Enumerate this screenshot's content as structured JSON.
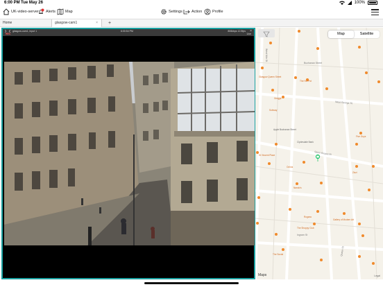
{
  "status": {
    "time": "6:00 PM",
    "date": "Tue May 26",
    "battery": "100%"
  },
  "toolbar": {
    "server": "UK-video-server",
    "alerts": "Alerts",
    "map": "Map",
    "settings": "Settings",
    "action": "Action",
    "profile": "Profile"
  },
  "tabs": {
    "home": "Home",
    "camera": "glasgow-cam1",
    "close": "×",
    "add": "+"
  },
  "video": {
    "name": "glasgow-cam1, input 1",
    "rec": "REC",
    "timestamp": "6:00:54 PM",
    "stats": "806kbps 12.5fps",
    "live": "Live"
  },
  "map": {
    "segment_map": "Map",
    "segment_satellite": "Satellite",
    "logo": "Maps",
    "legal": "Legal",
    "streets": [
      "Buchanan Street",
      "West George St",
      "Saint Vincent Pl",
      "West Nile St",
      "Queen St",
      "Ingram St"
    ],
    "pois": [
      "Glasgow Queen Street",
      "Glasgow Metro",
      "The Hot Pot",
      "Greggs",
      "The Social",
      "Apple Buchanan Street",
      "Clydesdale Bank",
      "Gallery of Modern Art",
      "The Shoppy Club",
      "St Vincent Place",
      "Mitchell Library",
      "Starbucks",
      "Subway",
      "Five Guys",
      "Ochos",
      "Royal Exchange Sq",
      "Zizzi",
      "Nando's",
      "Rogano"
    ],
    "colors": {
      "poi": "#f08a2c",
      "marker": "#27c46b",
      "road": "#ffffff"
    }
  }
}
